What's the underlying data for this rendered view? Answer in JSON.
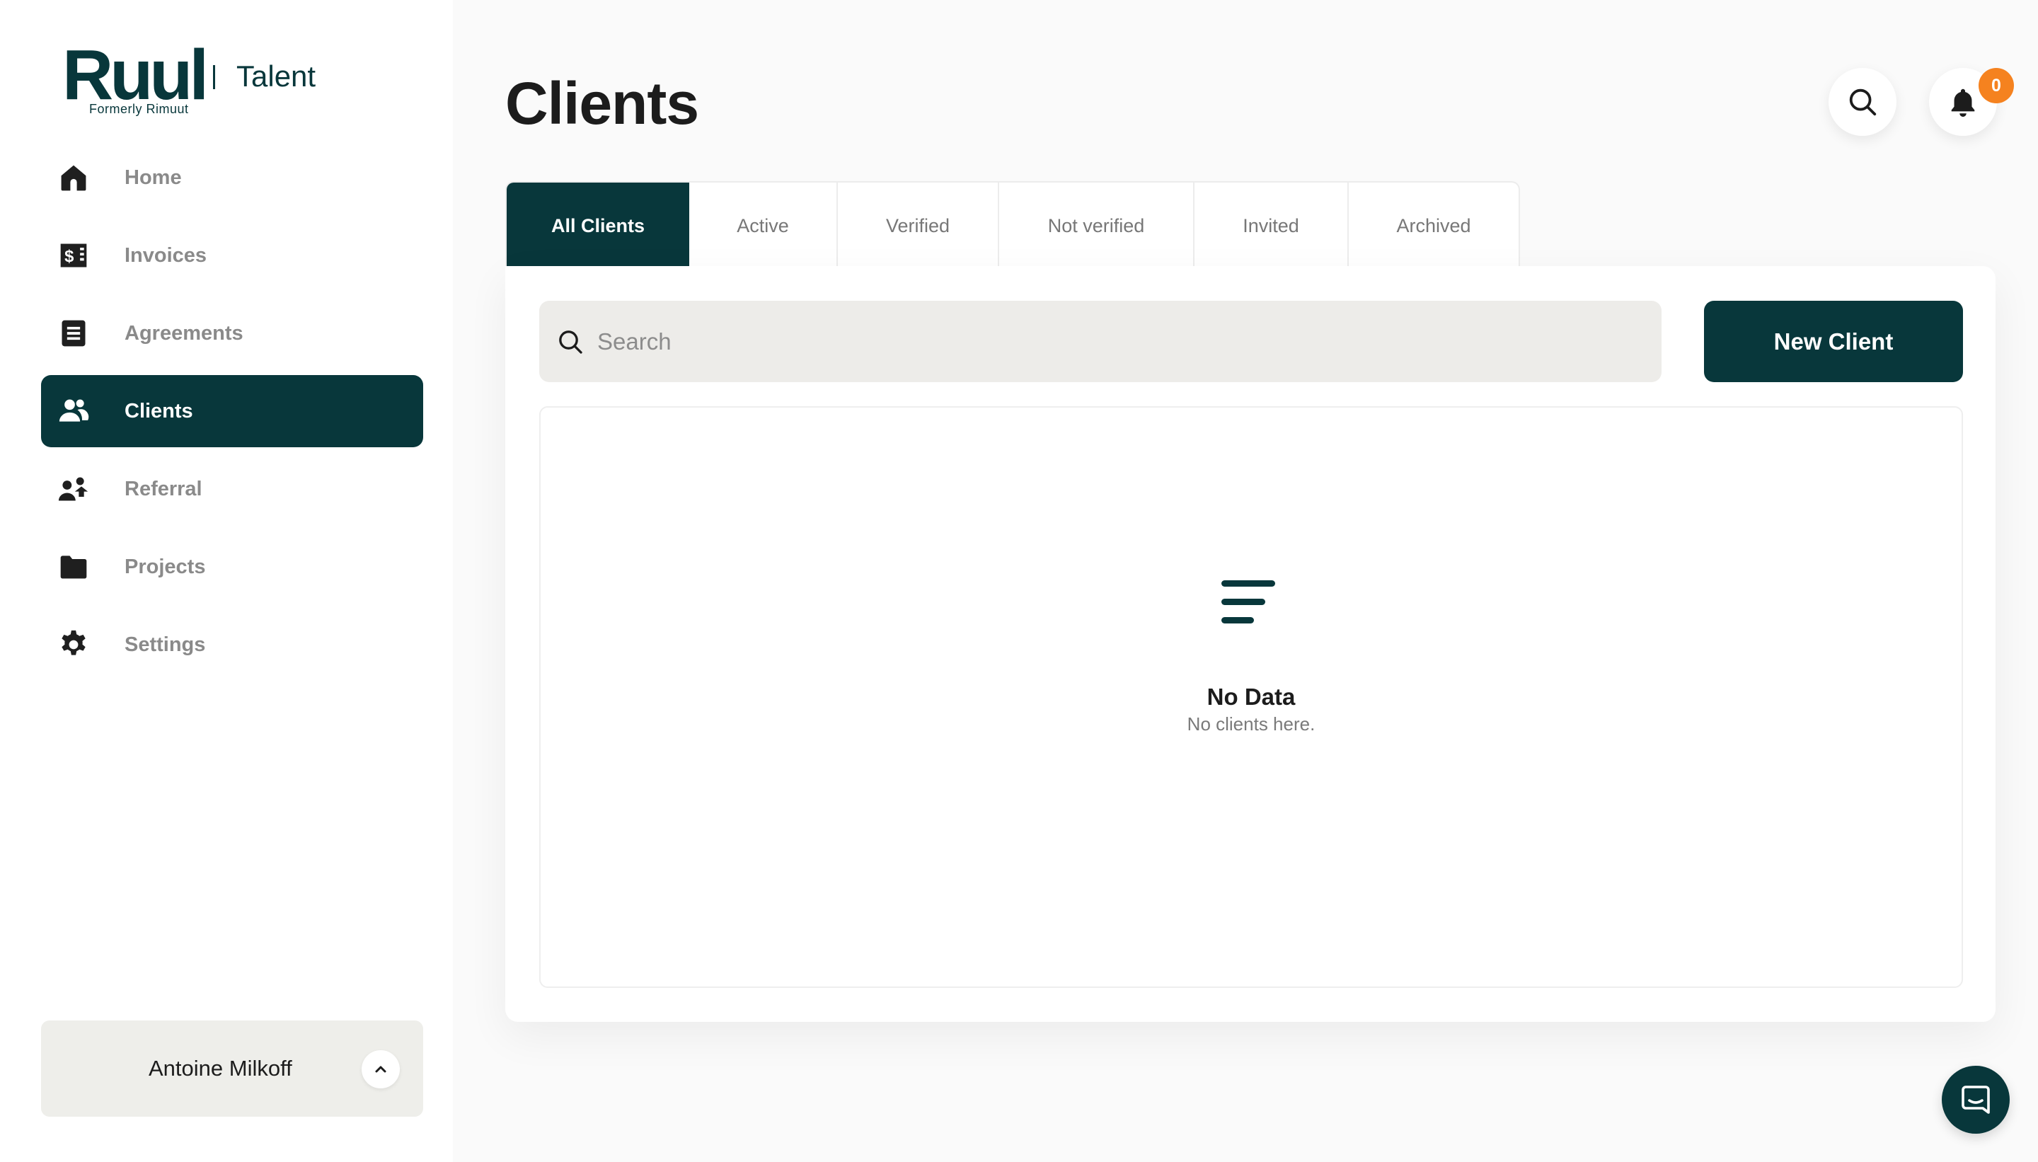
{
  "brand": {
    "logo_text": "Ruul",
    "logo_subtext": "Formerly Rimuut",
    "product": "Talent",
    "accent_color": "#08373b",
    "badge_color": "#f5821f"
  },
  "sidebar": {
    "items": [
      {
        "label": "Home",
        "icon": "home-icon"
      },
      {
        "label": "Invoices",
        "icon": "invoice-dollar-icon"
      },
      {
        "label": "Agreements",
        "icon": "document-icon"
      },
      {
        "label": "Clients",
        "icon": "users-icon",
        "active": true
      },
      {
        "label": "Referral",
        "icon": "referral-icon"
      },
      {
        "label": "Projects",
        "icon": "folder-icon"
      },
      {
        "label": "Settings",
        "icon": "gear-icon"
      }
    ],
    "user": {
      "name": "Antoine Milkoff",
      "toggle_icon": "chevron-up-icon"
    }
  },
  "header": {
    "title": "Clients",
    "search_icon": "search-icon",
    "notifications_icon": "bell-icon",
    "notification_count": "0"
  },
  "tabs": [
    {
      "label": "All Clients",
      "active": true
    },
    {
      "label": "Active"
    },
    {
      "label": "Verified"
    },
    {
      "label": "Not verified"
    },
    {
      "label": "Invited"
    },
    {
      "label": "Archived"
    }
  ],
  "main": {
    "search": {
      "placeholder": "Search",
      "value": ""
    },
    "new_client_label": "New Client",
    "empty_state": {
      "icon": "empty-list-icon",
      "title": "No Data",
      "subtitle": "No clients here."
    }
  },
  "chat": {
    "icon": "chat-icon"
  }
}
